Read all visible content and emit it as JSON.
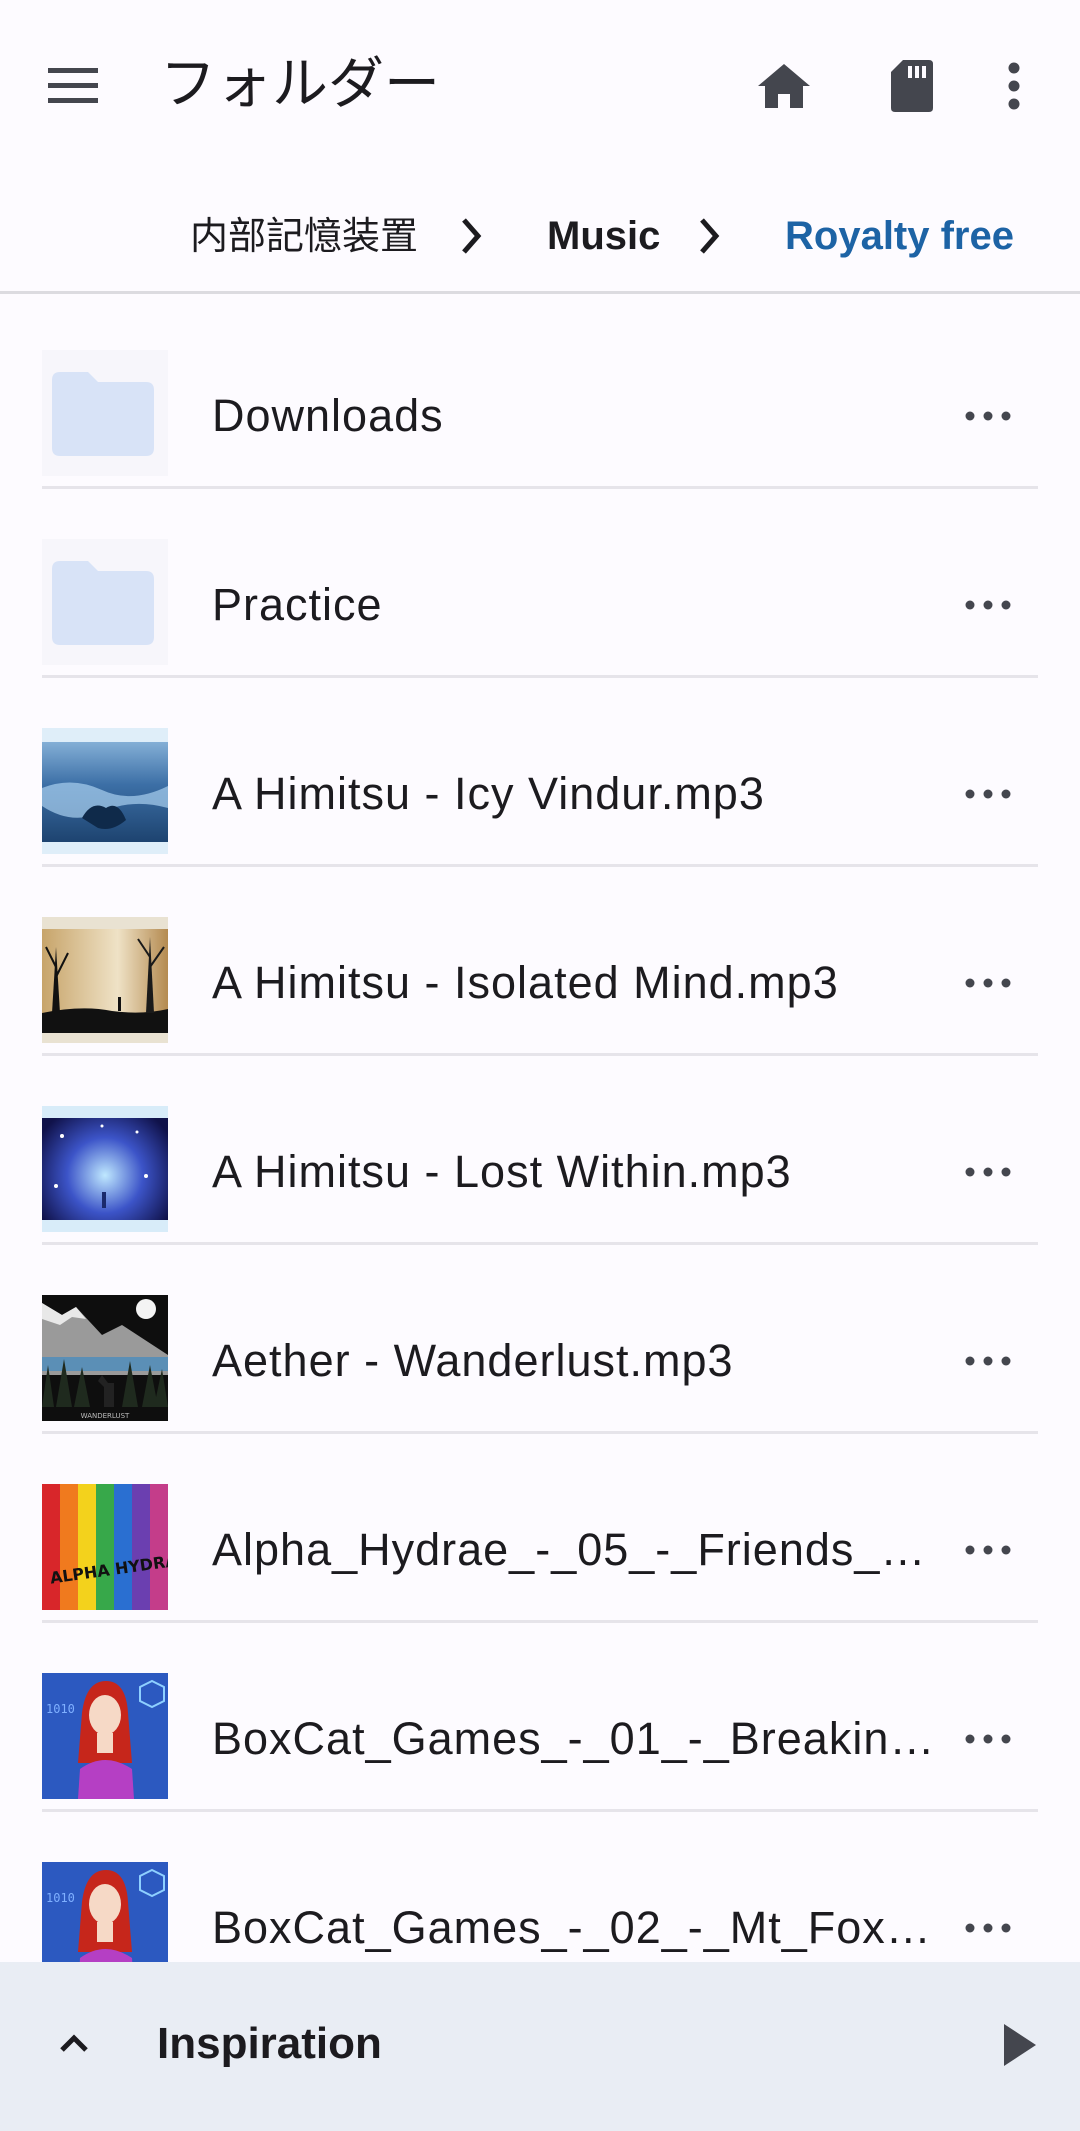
{
  "app_bar": {
    "title": "フォルダー",
    "menu_icon": "menu-icon",
    "actions": [
      "home-icon",
      "sd-card-icon",
      "more-vert-icon"
    ]
  },
  "breadcrumb": {
    "items": [
      "内部記憶装置",
      "Music",
      "Royalty free"
    ],
    "active_color": "#1d63a5"
  },
  "list": {
    "items": [
      {
        "label": "Downloads",
        "type": "folder"
      },
      {
        "label": "Practice",
        "type": "folder"
      },
      {
        "label": "A Himitsu - Icy Vindur.mp3",
        "type": "audio"
      },
      {
        "label": "A Himitsu - Isolated Mind.mp3",
        "type": "audio"
      },
      {
        "label": "A Himitsu - Lost Within.mp3",
        "type": "audio"
      },
      {
        "label": "Aether - Wanderlust.mp3",
        "type": "audio"
      },
      {
        "label": "Alpha_Hydrae_-_05_-_Friends_…",
        "type": "audio"
      },
      {
        "label": "BoxCat_Games_-_01_-_Breakin…",
        "type": "audio"
      },
      {
        "label": "BoxCat_Games_-_02_-_Mt_Fox…",
        "type": "audio"
      }
    ],
    "album_art_text": {
      "wanderlust": "WANDERLUST",
      "alpha_hydrae": "ALPHA HYDRAE",
      "boxcat_code": "1010"
    }
  },
  "player": {
    "title": "Inspiration",
    "expand_icon": "chevron-up-icon",
    "play_icon": "play-icon"
  }
}
